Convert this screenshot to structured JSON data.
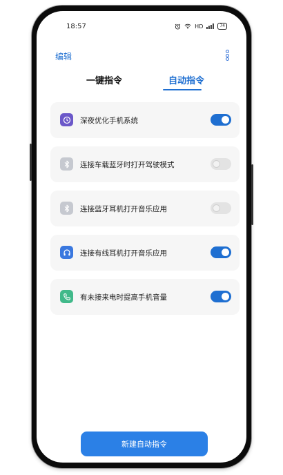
{
  "status_bar": {
    "time": "18:57",
    "network": "HD",
    "battery": "74"
  },
  "header": {
    "edit_label": "编辑",
    "more_icon": "more-vertical-icon"
  },
  "tabs": [
    {
      "label": "一键指令",
      "active": false
    },
    {
      "label": "自动指令",
      "active": true
    }
  ],
  "rules": [
    {
      "label": "深夜优化手机系统",
      "icon": "clock-icon",
      "icon_bg": "#6b58c9",
      "enabled": true
    },
    {
      "label": "连接车载蓝牙时打开驾驶模式",
      "icon": "bluetooth-icon",
      "icon_bg": "#c6c9d0",
      "enabled": false
    },
    {
      "label": "连接蓝牙耳机打开音乐应用",
      "icon": "bluetooth-icon",
      "icon_bg": "#c6c9d0",
      "enabled": false
    },
    {
      "label": "连接有线耳机打开音乐应用",
      "icon": "headphones-icon",
      "icon_bg": "#3a78df",
      "enabled": true
    },
    {
      "label": "有未接来电时提高手机音量",
      "icon": "phone-icon",
      "icon_bg": "#41b98a",
      "enabled": true
    }
  ],
  "new_button_label": "新建自动指令",
  "colors": {
    "accent": "#1f6fd1",
    "button": "#2b80e6"
  }
}
